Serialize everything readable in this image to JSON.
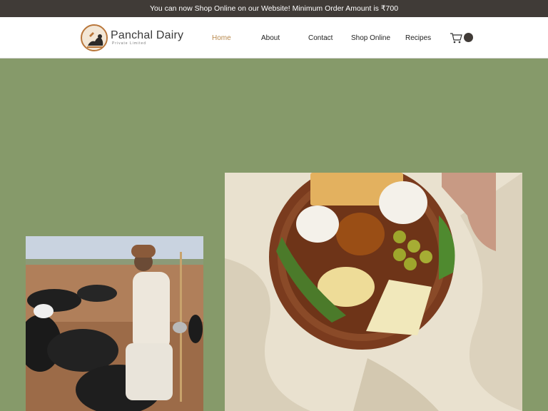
{
  "announcement": "You can now Shop Online on our Website! Minimum Order Amount is ₹700",
  "brand": {
    "name": "Panchal Dairy",
    "subtitle": "Private Limited"
  },
  "nav": {
    "items": [
      {
        "label": "Home",
        "active": true
      },
      {
        "label": "About"
      },
      {
        "label": "Contact"
      },
      {
        "label": "Shop Online"
      },
      {
        "label": "Recipes"
      }
    ]
  },
  "cart": {
    "icon": "cart-icon"
  },
  "images": {
    "left": "shepherd-with-goats-photo",
    "right": "cheese-platter-photo"
  },
  "colors": {
    "announcement_bg": "#403b37",
    "page_bg": "#869a6a",
    "nav_active": "#b8894d"
  }
}
